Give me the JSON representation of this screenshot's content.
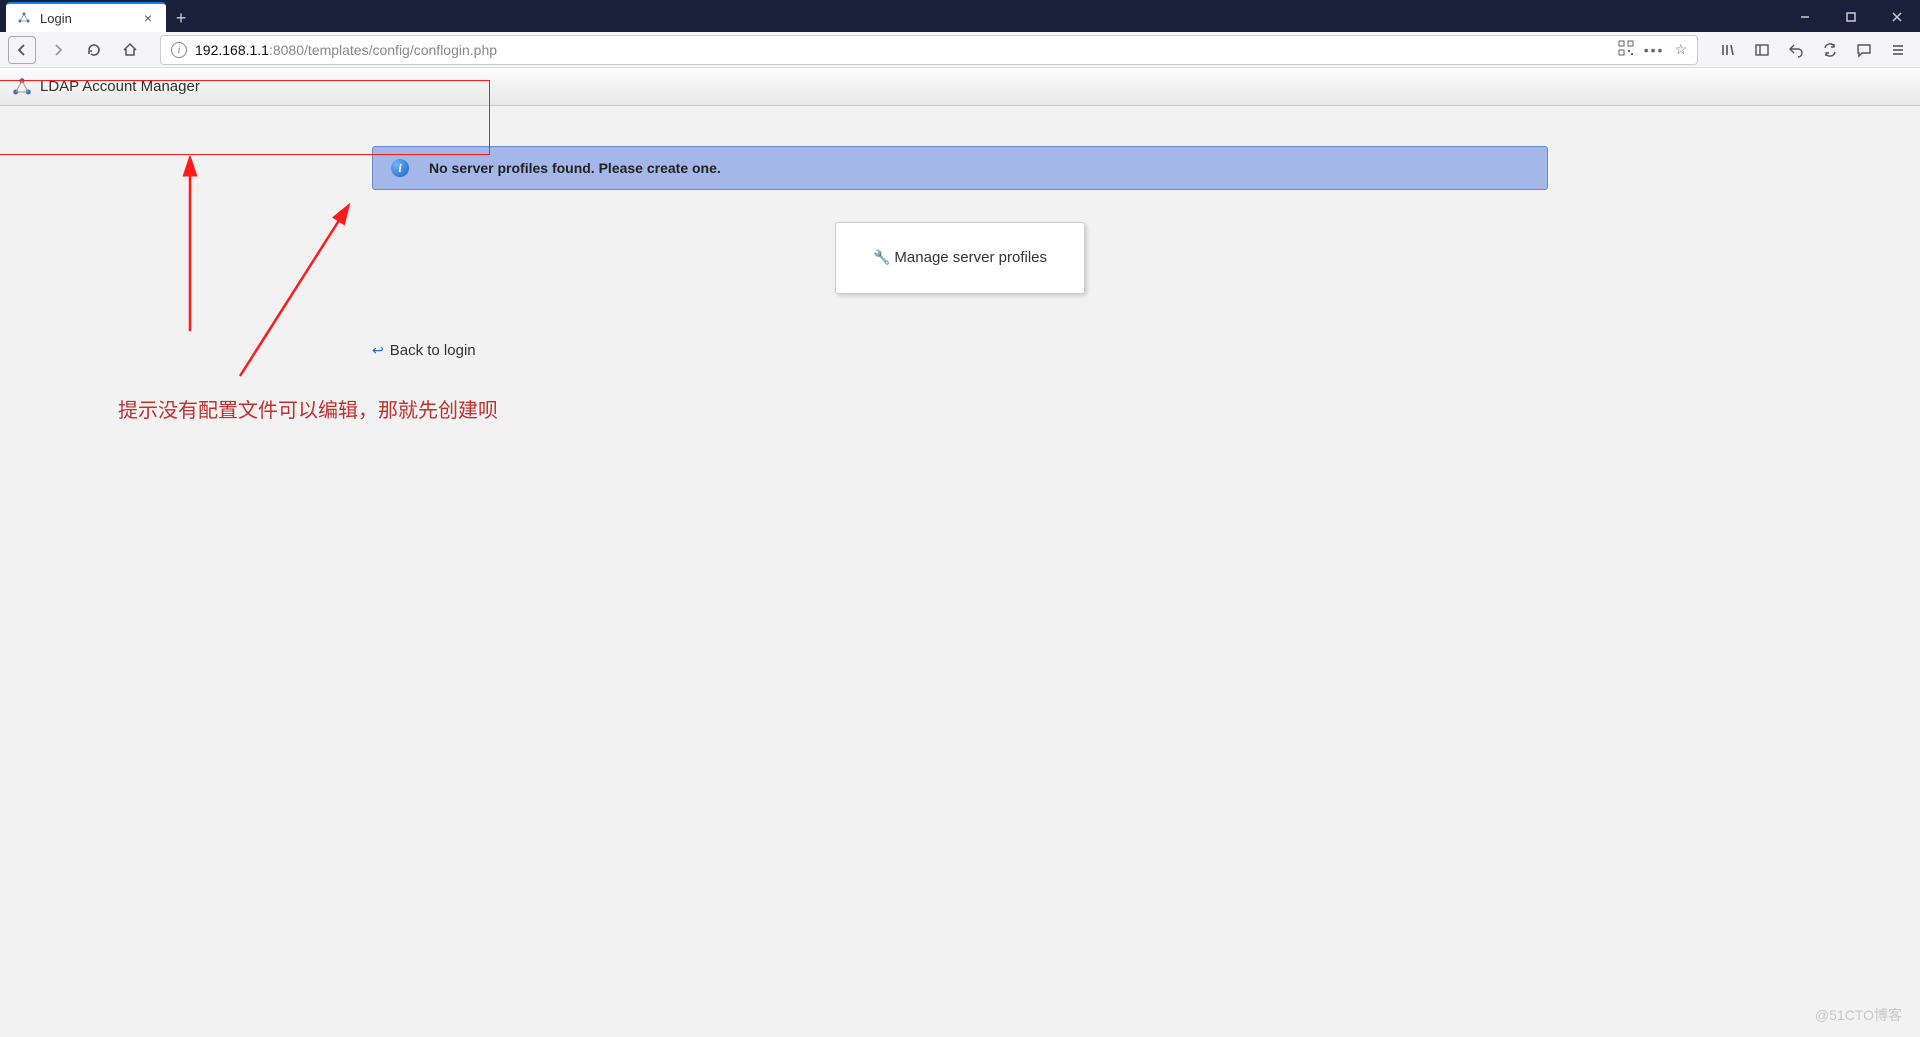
{
  "browser": {
    "tab_title": "Login",
    "url_host": "192.168.1.1",
    "url_port_path": ":8080/templates/config/conflogin.php"
  },
  "header": {
    "app_name": "LDAP Account Manager"
  },
  "notice": {
    "message": "No server profiles found. Please create one."
  },
  "card": {
    "manage_label": "Manage server profiles"
  },
  "back": {
    "label": "Back to login"
  },
  "annotation": {
    "note": "提示没有配置文件可以编辑，那就先创建呗"
  },
  "watermark": "@51CTO博客"
}
